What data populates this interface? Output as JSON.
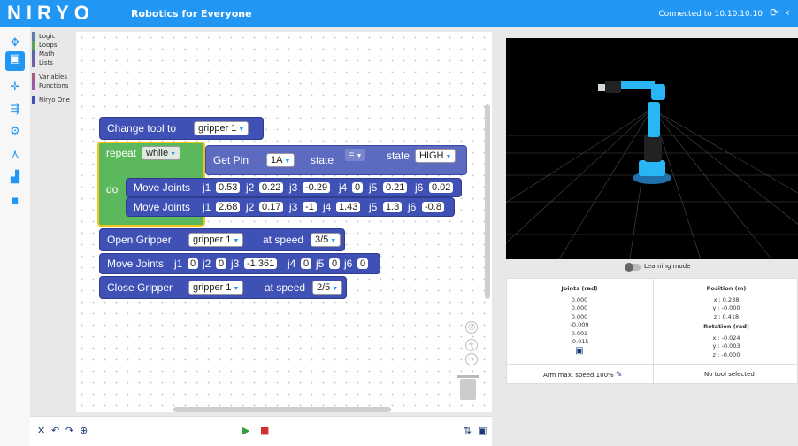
{
  "header": {
    "logo": "NIRYO",
    "tagline": "Robotics for Everyone",
    "connection": "Connected to 10.10.10.10"
  },
  "categories": [
    {
      "label": "Logic",
      "color": "#5b80a5"
    },
    {
      "label": "Loops",
      "color": "#5ba55b"
    },
    {
      "label": "Math",
      "color": "#5b67a5"
    },
    {
      "label": "Lists",
      "color": "#745ba5"
    },
    {
      "label": "Variables",
      "color": "#a55b80"
    },
    {
      "label": "Functions",
      "color": "#995ba5"
    },
    {
      "label": "Niryo One",
      "color": "#3f51b5"
    }
  ],
  "blocks": {
    "change_tool": {
      "label": "Change tool to",
      "value": "gripper 1"
    },
    "repeat": {
      "label": "repeat",
      "mode": "while",
      "do": "do"
    },
    "get_pin": {
      "label": "Get Pin",
      "pin": "1A",
      "state_label": "state"
    },
    "compare": {
      "op": "="
    },
    "state": {
      "label": "state",
      "value": "HIGH"
    },
    "move1": {
      "label": "Move Joints",
      "j1": "j1",
      "v1": "0.53",
      "j2": "j2",
      "v2": "0.22",
      "j3": "j3",
      "v3": "-0.29",
      "j4": "j4",
      "v4": "0",
      "j5": "j5",
      "v5": "0.21",
      "j6": "j6",
      "v6": "0.02"
    },
    "move2": {
      "label": "Move Joints",
      "j1": "j1",
      "v1": "2.68",
      "j2": "j2",
      "v2": "0.17",
      "j3": "j3",
      "v3": "-1",
      "j4": "j4",
      "v4": "1.43",
      "j5": "j5",
      "v5": "1.3",
      "j6": "j6",
      "v6": "-0.8"
    },
    "open_gripper": {
      "label": "Open Gripper",
      "value": "gripper 1",
      "speed_label": "at speed",
      "speed": "3/5"
    },
    "move3": {
      "label": "Move Joints",
      "j1": "j1",
      "v1": "0",
      "j2": "j2",
      "v2": "0",
      "j3": "j3",
      "v3": "-1.361",
      "j4": "j4",
      "v4": "0",
      "j5": "j5",
      "v5": "0",
      "j6": "j6",
      "v6": "0"
    },
    "close_gripper": {
      "label": "Close Gripper",
      "value": "gripper 1",
      "speed_label": "at speed",
      "speed": "2/5"
    }
  },
  "robot_panel": {
    "learning_mode": "Learning mode",
    "joints_title": "Joints (rad)",
    "joints": [
      "0.000",
      "0.000",
      "0.000",
      "-0.009",
      "0.003",
      "-0.015"
    ],
    "position_title": "Position (m)",
    "position": [
      "x : 0.238",
      "y : -0.000",
      "z : 0.418"
    ],
    "rotation_title": "Rotation (rad)",
    "rotation": [
      "x : -0.024",
      "y : -0.003",
      "z : -0.000"
    ],
    "arm_speed": "Arm max. speed 100%",
    "tool": "No tool selected"
  },
  "colors": {
    "accent": "#2196f3",
    "block": "#3f51b5",
    "loop": "#5cb85c",
    "highlight": "#f0c419"
  }
}
